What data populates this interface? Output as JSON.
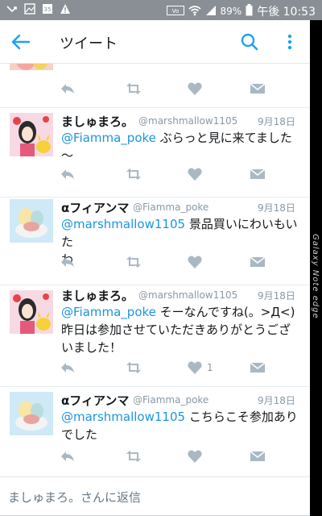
{
  "status_bar": {
    "battery": "89%",
    "time": "午後 10:53"
  },
  "app_bar": {
    "title": "ツイート"
  },
  "tweets": [
    {
      "name": "ましゅまろ。",
      "handle": "@marshmallow1105",
      "date": "9月18日",
      "mention": "@Fiamma_poke",
      "text_line1": " ぶらっと見に来てました",
      "text_line2": "～",
      "likes": ""
    },
    {
      "name": "αフィアンマ",
      "handle": "@Fiamma_poke",
      "date": "9月18日",
      "mention": "@marshmallow1105",
      "text_line1": " 景品買いにわいもいた",
      "text_line2": "わ",
      "likes": ""
    },
    {
      "name": "ましゅまろ。",
      "handle": "@marshmallow1105",
      "date": "9月18日",
      "mention": "@Fiamma_poke",
      "text_line1": " そーなんですね(。>Д<)",
      "text_line2": "昨日は参加させていただきありがとうござ",
      "text_line3": "いました！",
      "likes": "1"
    },
    {
      "name": "αフィアンマ",
      "handle": "@Fiamma_poke",
      "date": "9月18日",
      "mention": "@marshmallow1105",
      "text_line1": " こちらこそ参加あり",
      "text_line2": "でした",
      "likes": ""
    }
  ],
  "edge_label": "Galaxy Note edge",
  "reply": {
    "placeholder": "ましゅまろ。さんに返信"
  }
}
